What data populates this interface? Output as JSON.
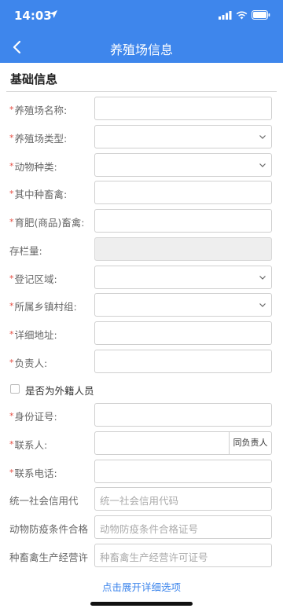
{
  "status_bar": {
    "time": "14:03"
  },
  "header": {
    "title": "养殖场信息"
  },
  "section": {
    "title": "基础信息"
  },
  "fields": [
    {
      "label": "养殖场名称:",
      "required": true
    },
    {
      "label": "养殖场类型:",
      "required": true
    },
    {
      "label": "动物种类:",
      "required": true
    },
    {
      "label": "其中种畜禽:",
      "required": true
    },
    {
      "label": "育肥(商品)畜禽:",
      "required": true
    },
    {
      "label": "存栏量:",
      "required": false
    },
    {
      "label": "登记区域:",
      "required": true
    },
    {
      "label": "所属乡镇村组:",
      "required": true
    },
    {
      "label": "详细地址:",
      "required": true
    },
    {
      "label": "负责人:",
      "required": true
    },
    {
      "label": "身份证号:",
      "required": true
    },
    {
      "label": "联系人:",
      "required": true
    },
    {
      "label": "联系电话:",
      "required": true
    },
    {
      "label": "统一社会信用代",
      "placeholder": "统一社会信用代码"
    },
    {
      "label": "动物防疫条件合格",
      "placeholder": "动物防疫条件合格证号"
    },
    {
      "label": "种畜禽生产经营许",
      "placeholder": "种畜禽生产经营许可证号"
    }
  ],
  "checkbox": {
    "label": "是否为外籍人员"
  },
  "same_as_owner": "同负责人",
  "expand_link": "点击展开详细选项",
  "required_mark": "*"
}
